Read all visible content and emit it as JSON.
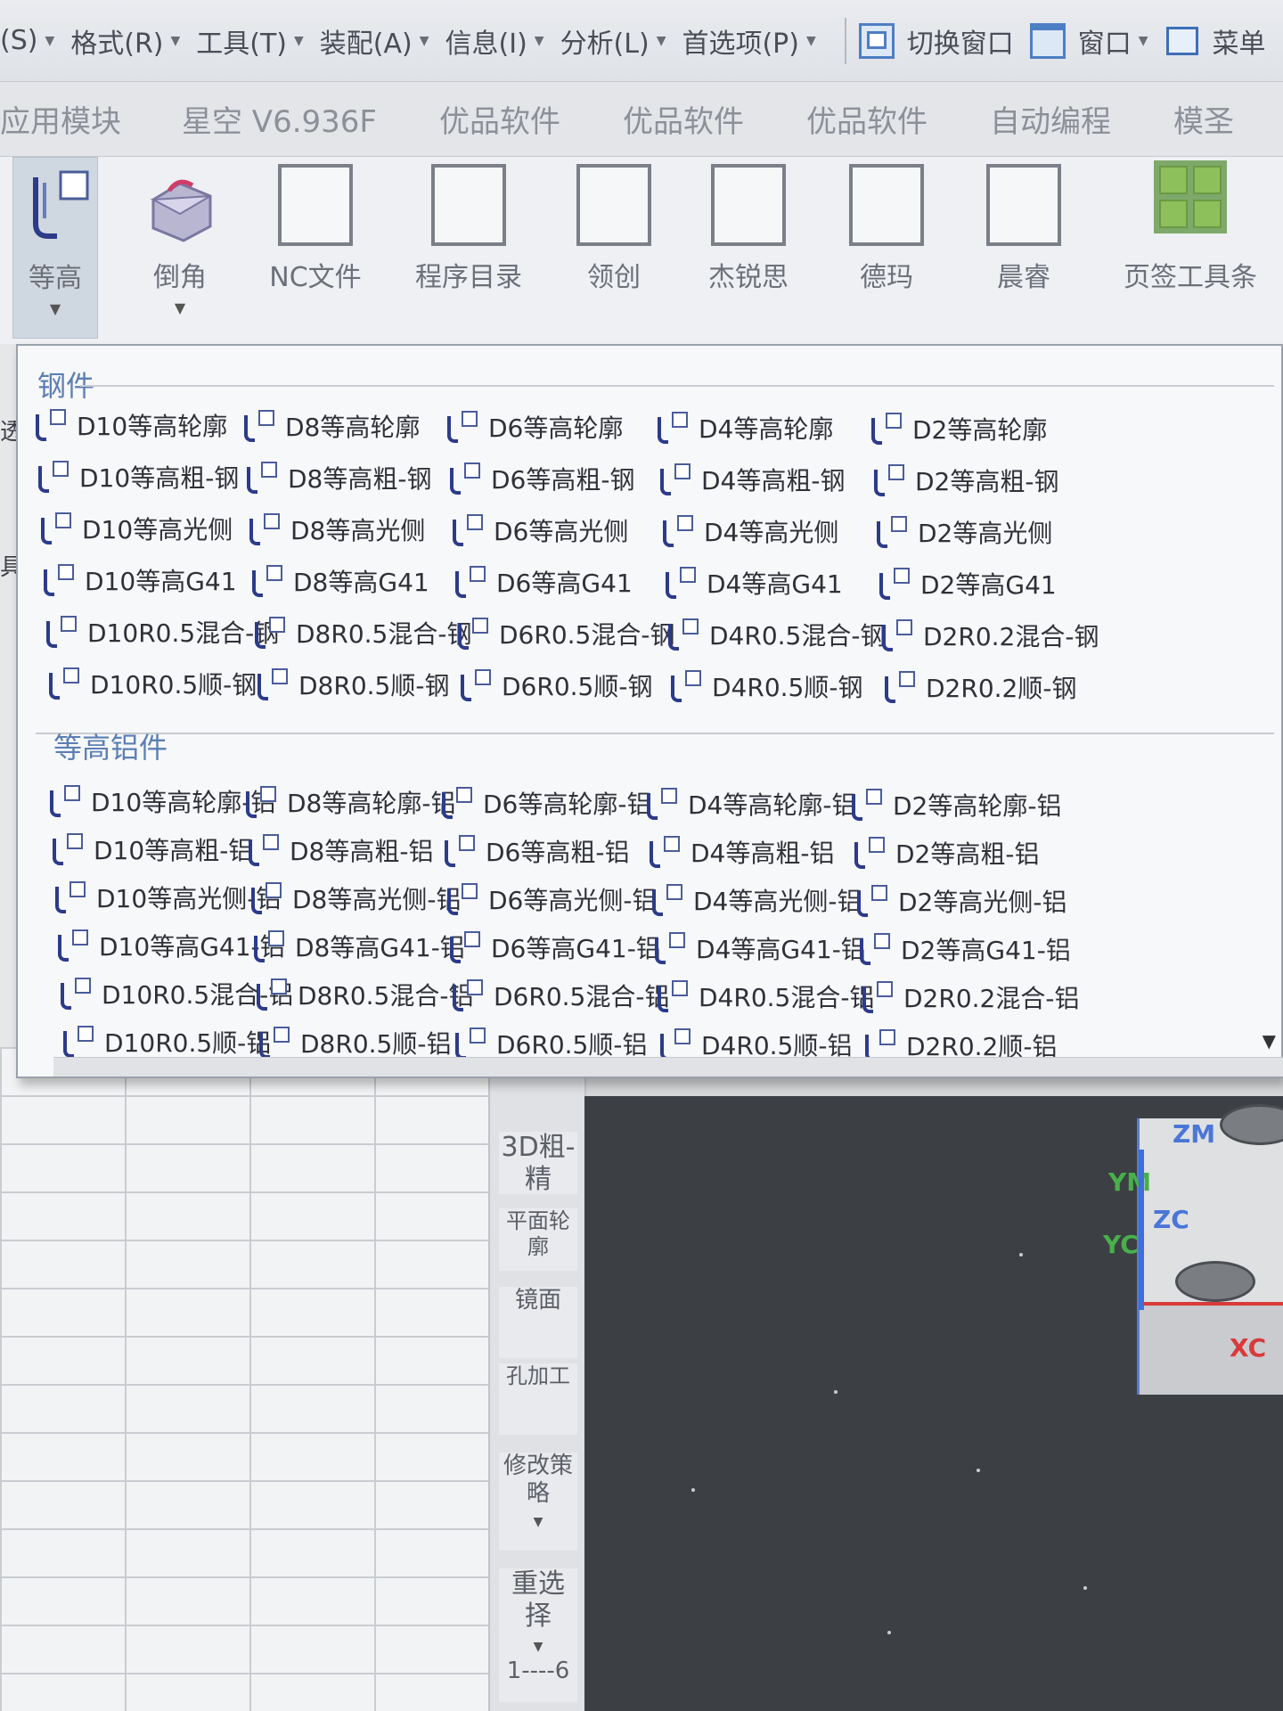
{
  "menubar": {
    "items": [
      "(S)",
      "格式(R)",
      "工具(T)",
      "装配(A)",
      "信息(I)",
      "分析(L)",
      "首选项(P)"
    ],
    "switch_window": "切换窗口",
    "window": "窗口",
    "menu": "菜单"
  },
  "tabs": [
    "应用模块",
    "星空 V6.936F",
    "优品软件",
    "优品软件",
    "优品软件",
    "自动编程",
    "模圣"
  ],
  "ribbon": {
    "buttons": [
      "等高",
      "倒角",
      "NC文件",
      "程序目录",
      "领创",
      "杰锐思",
      "德玛",
      "晨睿",
      "页签工具条"
    ]
  },
  "sidebar": {
    "frag1": "透",
    "frag2": "具"
  },
  "popup": {
    "group_steel": "钢件",
    "steel_items": [
      "D10等高轮廓",
      "D8等高轮廓",
      "D6等高轮廓",
      "D4等高轮廓",
      "D2等高轮廓",
      "D10等高粗-钢",
      "D8等高粗-钢",
      "D6等高粗-钢",
      "D4等高粗-钢",
      "D2等高粗-钢",
      "D10等高光侧",
      "D8等高光侧",
      "D6等高光侧",
      "D4等高光侧",
      "D2等高光侧",
      "D10等高G41",
      "D8等高G41",
      "D6等高G41",
      "D4等高G41",
      "D2等高G41",
      "D10R0.5混合-钢",
      "D8R0.5混合-钢",
      "D6R0.5混合-钢",
      "D4R0.5混合-钢",
      "D2R0.2混合-钢",
      "D10R0.5顺-钢",
      "D8R0.5顺-钢",
      "D6R0.5顺-钢",
      "D4R0.5顺-钢",
      "D2R0.2顺-钢"
    ],
    "group_alu": "等高铝件",
    "alu_items": [
      "D10等高轮廓-铝",
      "D8等高轮廓-铝",
      "D6等高轮廓-铝",
      "D4等高轮廓-铝",
      "D2等高轮廓-铝",
      "D10等高粗-铝",
      "D8等高粗-铝",
      "D6等高粗-铝",
      "D4等高粗-铝",
      "D2等高粗-铝",
      "D10等高光侧-铝",
      "D8等高光侧-铝",
      "D6等高光侧-铝",
      "D4等高光侧-铝",
      "D2等高光侧-铝",
      "D10等高G41-铝",
      "D8等高G41-铝",
      "D6等高G41-铝",
      "D4等高G41-铝",
      "D2等高G41-铝",
      "D10R0.5混合-铝",
      "D8R0.5混合-铝",
      "D6R0.5混合-铝",
      "D4R0.5混合-铝",
      "D2R0.2混合-铝",
      "D10R0.5顺-铝",
      "D8R0.5顺-铝",
      "D6R0.5顺-铝",
      "D4R0.5顺-铝",
      "D2R0.2顺-铝"
    ]
  },
  "vtoolbar": {
    "items": [
      "3D粗-精",
      "平面轮廓",
      "镜面",
      "孔加工",
      "修改策略",
      "重选择",
      "1----6"
    ]
  },
  "viewport": {
    "zm": "ZM",
    "yc": "YC",
    "zc": "ZC",
    "xc": "XC",
    "ym": "YM"
  }
}
